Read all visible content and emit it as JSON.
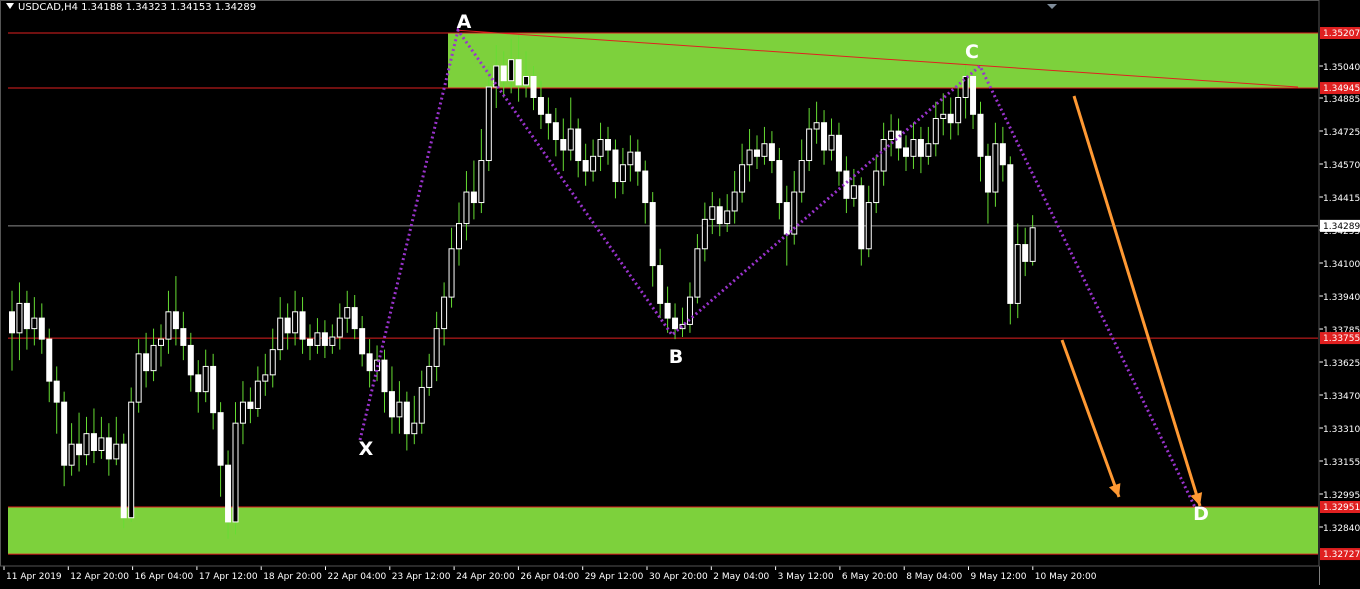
{
  "header": {
    "symbol": "USDCAD,H4",
    "ohlc": "1.34188 1.34323 1.34153 1.34289"
  },
  "colors": {
    "background": "#000000",
    "candle": "#ffffff",
    "wick": "#66dd33",
    "zone_fill": "#7dd13c",
    "level_line": "#e02020",
    "harmonic_line": "#9933cc",
    "arrow": "#ff9933",
    "price_label_bg": "#e02020"
  },
  "chart_data": {
    "type": "candlestick",
    "y_range": [
      1.32727,
      1.3524
    ],
    "price_axis_labels": [
      "1.35040",
      "1.34885",
      "1.34725",
      "1.34570",
      "1.34415",
      "1.34255",
      "1.34100",
      "1.33940",
      "1.33785",
      "1.33625",
      "1.33470",
      "1.33310",
      "1.33155",
      "1.32995",
      "1.32840"
    ],
    "highlighted_prices": [
      "1.35207",
      "1.34945",
      "1.33755",
      "1.32951",
      "1.32727"
    ],
    "current_price": "1.34289",
    "time_labels": [
      "11 Apr 2019",
      "12 Apr 20:00",
      "16 Apr 04:00",
      "17 Apr 12:00",
      "18 Apr 20:00",
      "22 Apr 04:00",
      "23 Apr 12:00",
      "24 Apr 20:00",
      "26 Apr 04:00",
      "29 Apr 12:00",
      "30 Apr 20:00",
      "2 May 04:00",
      "3 May 12:00",
      "6 May 20:00",
      "8 May 04:00",
      "9 May 12:00",
      "10 May 20:00"
    ],
    "zones": [
      {
        "name": "upper",
        "from": 1.34945,
        "to": 1.35207
      },
      {
        "name": "lower",
        "from": 1.32727,
        "to": 1.32951
      }
    ],
    "levels": [
      1.35207,
      1.34945,
      1.33755,
      1.32951,
      1.32727
    ],
    "pattern_points": [
      {
        "label": "X",
        "price": 1.3327
      },
      {
        "label": "A",
        "price": 1.3522
      },
      {
        "label": "B",
        "price": 1.3377
      },
      {
        "label": "C",
        "price": 1.3505
      },
      {
        "label": "D",
        "price": 1.3295
      }
    ],
    "trendline": {
      "from_price": 1.3522,
      "to_price": 1.3495
    },
    "candles": [
      [
        1.3388,
        1.3378,
        1.3398,
        1.336
      ],
      [
        1.3378,
        1.3392,
        1.3402,
        1.3365
      ],
      [
        1.3392,
        1.338,
        1.3398,
        1.337
      ],
      [
        1.338,
        1.3385,
        1.3395,
        1.3372
      ],
      [
        1.3385,
        1.3375,
        1.3392,
        1.3368
      ],
      [
        1.3375,
        1.3355,
        1.338,
        1.3345
      ],
      [
        1.3355,
        1.3345,
        1.3362,
        1.333
      ],
      [
        1.3345,
        1.3315,
        1.335,
        1.3305
      ],
      [
        1.3315,
        1.3325,
        1.3335,
        1.331
      ],
      [
        1.3325,
        1.332,
        1.334,
        1.3312
      ],
      [
        1.332,
        1.333,
        1.3338,
        1.3315
      ],
      [
        1.333,
        1.3322,
        1.3342,
        1.3316
      ],
      [
        1.3322,
        1.3328,
        1.3338,
        1.3318
      ],
      [
        1.3328,
        1.3318,
        1.3335,
        1.331
      ],
      [
        1.3318,
        1.3325,
        1.3338,
        1.3315
      ],
      [
        1.3325,
        1.329,
        1.333,
        1.3285
      ],
      [
        1.329,
        1.3345,
        1.3352,
        1.3288
      ],
      [
        1.3345,
        1.3368,
        1.3375,
        1.334
      ],
      [
        1.3368,
        1.336,
        1.3378,
        1.3352
      ],
      [
        1.336,
        1.3372,
        1.338,
        1.3355
      ],
      [
        1.3372,
        1.3375,
        1.3382,
        1.3362
      ],
      [
        1.3375,
        1.3388,
        1.3398,
        1.3368
      ],
      [
        1.3388,
        1.338,
        1.3405,
        1.3372
      ],
      [
        1.338,
        1.3372,
        1.3388,
        1.3365
      ],
      [
        1.3372,
        1.3358,
        1.3378,
        1.335
      ],
      [
        1.3358,
        1.335,
        1.3365,
        1.334
      ],
      [
        1.335,
        1.3362,
        1.337,
        1.3345
      ],
      [
        1.3362,
        1.334,
        1.3368,
        1.3332
      ],
      [
        1.334,
        1.3315,
        1.3345,
        1.33
      ],
      [
        1.3315,
        1.3288,
        1.3322,
        1.328
      ],
      [
        1.3288,
        1.3335,
        1.3345,
        1.3282
      ],
      [
        1.3335,
        1.3345,
        1.3355,
        1.3325
      ],
      [
        1.3345,
        1.3342,
        1.3352,
        1.3335
      ],
      [
        1.3342,
        1.3355,
        1.3362,
        1.3338
      ],
      [
        1.3355,
        1.3358,
        1.3368,
        1.3348
      ],
      [
        1.3358,
        1.337,
        1.338,
        1.3352
      ],
      [
        1.337,
        1.3385,
        1.3395,
        1.3365
      ],
      [
        1.3385,
        1.3378,
        1.3392,
        1.337
      ],
      [
        1.3378,
        1.3388,
        1.3398,
        1.3372
      ],
      [
        1.3388,
        1.3375,
        1.3395,
        1.3368
      ],
      [
        1.3375,
        1.3372,
        1.3382,
        1.3365
      ],
      [
        1.3372,
        1.3378,
        1.3385,
        1.3368
      ],
      [
        1.3378,
        1.3372,
        1.3384,
        1.3366
      ],
      [
        1.3372,
        1.3376,
        1.3382,
        1.3368
      ],
      [
        1.3376,
        1.3385,
        1.3392,
        1.337
      ],
      [
        1.3385,
        1.339,
        1.3398,
        1.3378
      ],
      [
        1.339,
        1.338,
        1.3396,
        1.3375
      ],
      [
        1.338,
        1.3368,
        1.3386,
        1.3362
      ],
      [
        1.3368,
        1.336,
        1.3375,
        1.3352
      ],
      [
        1.336,
        1.3365,
        1.3372,
        1.3355
      ],
      [
        1.3365,
        1.335,
        1.337,
        1.334
      ],
      [
        1.335,
        1.3338,
        1.3362,
        1.333
      ],
      [
        1.3338,
        1.3345,
        1.3355,
        1.333
      ],
      [
        1.3345,
        1.333,
        1.335,
        1.3322
      ],
      [
        1.333,
        1.3335,
        1.3348,
        1.3325
      ],
      [
        1.3335,
        1.3352,
        1.336,
        1.333
      ],
      [
        1.3352,
        1.3362,
        1.3368,
        1.3348
      ],
      [
        1.3362,
        1.338,
        1.3388,
        1.3355
      ],
      [
        1.338,
        1.3395,
        1.3402,
        1.3372
      ],
      [
        1.3395,
        1.3418,
        1.3428,
        1.339
      ],
      [
        1.3418,
        1.343,
        1.344,
        1.341
      ],
      [
        1.343,
        1.3445,
        1.3455,
        1.3422
      ],
      [
        1.3445,
        1.344,
        1.346,
        1.3432
      ],
      [
        1.344,
        1.346,
        1.3475,
        1.3435
      ],
      [
        1.346,
        1.3495,
        1.3505,
        1.3455
      ],
      [
        1.3495,
        1.3505,
        1.3515,
        1.3485
      ],
      [
        1.3505,
        1.3498,
        1.3512,
        1.349
      ],
      [
        1.3498,
        1.3508,
        1.3518,
        1.3492
      ],
      [
        1.3508,
        1.3496,
        1.352,
        1.3488
      ],
      [
        1.3496,
        1.35,
        1.3512,
        1.349
      ],
      [
        1.35,
        1.349,
        1.3505,
        1.3484
      ],
      [
        1.349,
        1.3482,
        1.3498,
        1.3475
      ],
      [
        1.3482,
        1.3478,
        1.349,
        1.347
      ],
      [
        1.3478,
        1.347,
        1.3485,
        1.3462
      ],
      [
        1.347,
        1.3465,
        1.348,
        1.3455
      ],
      [
        1.3465,
        1.3475,
        1.349,
        1.346
      ],
      [
        1.3475,
        1.346,
        1.348,
        1.3452
      ],
      [
        1.346,
        1.3455,
        1.3468,
        1.3448
      ],
      [
        1.3455,
        1.3462,
        1.347,
        1.345
      ],
      [
        1.3462,
        1.347,
        1.3478,
        1.3455
      ],
      [
        1.347,
        1.3465,
        1.3476,
        1.3458
      ],
      [
        1.3465,
        1.345,
        1.347,
        1.3442
      ],
      [
        1.345,
        1.3458,
        1.3466,
        1.3444
      ],
      [
        1.3458,
        1.3464,
        1.3472,
        1.345
      ],
      [
        1.3464,
        1.3455,
        1.347,
        1.3448
      ],
      [
        1.3455,
        1.344,
        1.346,
        1.343
      ],
      [
        1.344,
        1.341,
        1.3445,
        1.34
      ],
      [
        1.341,
        1.3392,
        1.3418,
        1.3385
      ],
      [
        1.3392,
        1.3385,
        1.34,
        1.3378
      ],
      [
        1.3385,
        1.338,
        1.3392,
        1.3375
      ],
      [
        1.338,
        1.3382,
        1.339,
        1.3376
      ],
      [
        1.3382,
        1.3395,
        1.3402,
        1.3378
      ],
      [
        1.3395,
        1.3418,
        1.3425,
        1.3392
      ],
      [
        1.3418,
        1.3432,
        1.344,
        1.3412
      ],
      [
        1.3432,
        1.3438,
        1.3445,
        1.3425
      ],
      [
        1.3438,
        1.343,
        1.3442,
        1.3424
      ],
      [
        1.343,
        1.3436,
        1.3444,
        1.3426
      ],
      [
        1.3436,
        1.3445,
        1.3455,
        1.343
      ],
      [
        1.3445,
        1.3458,
        1.3468,
        1.344
      ],
      [
        1.3458,
        1.3465,
        1.3475,
        1.345
      ],
      [
        1.3465,
        1.3462,
        1.3472,
        1.3456
      ],
      [
        1.3462,
        1.3468,
        1.3476,
        1.3458
      ],
      [
        1.3468,
        1.346,
        1.3474,
        1.3454
      ],
      [
        1.346,
        1.344,
        1.3466,
        1.3432
      ],
      [
        1.344,
        1.3425,
        1.3448,
        1.341
      ],
      [
        1.3425,
        1.3445,
        1.3455,
        1.342
      ],
      [
        1.3445,
        1.346,
        1.347,
        1.344
      ],
      [
        1.346,
        1.3475,
        1.3485,
        1.3455
      ],
      [
        1.3475,
        1.3478,
        1.3488,
        1.3468
      ],
      [
        1.3478,
        1.3465,
        1.3484,
        1.3458
      ],
      [
        1.3465,
        1.3472,
        1.348,
        1.346
      ],
      [
        1.3472,
        1.3455,
        1.3478,
        1.3448
      ],
      [
        1.3455,
        1.3442,
        1.3462,
        1.3435
      ],
      [
        1.3442,
        1.3448,
        1.3456,
        1.3438
      ],
      [
        1.3448,
        1.3418,
        1.3452,
        1.341
      ],
      [
        1.3418,
        1.344,
        1.3448,
        1.3414
      ],
      [
        1.344,
        1.3455,
        1.3462,
        1.3435
      ],
      [
        1.3455,
        1.347,
        1.3478,
        1.3448
      ],
      [
        1.347,
        1.3474,
        1.3482,
        1.3462
      ],
      [
        1.3474,
        1.3466,
        1.348,
        1.346
      ],
      [
        1.3466,
        1.3462,
        1.3472,
        1.3455
      ],
      [
        1.3462,
        1.347,
        1.3478,
        1.3456
      ],
      [
        1.347,
        1.3462,
        1.3476,
        1.3454
      ],
      [
        1.3462,
        1.3468,
        1.3476,
        1.3458
      ],
      [
        1.3468,
        1.348,
        1.3488,
        1.3462
      ],
      [
        1.348,
        1.3482,
        1.3492,
        1.3472
      ],
      [
        1.3482,
        1.3478,
        1.349,
        1.347
      ],
      [
        1.3478,
        1.349,
        1.3498,
        1.3472
      ],
      [
        1.349,
        1.35,
        1.3506,
        1.348
      ],
      [
        1.35,
        1.3482,
        1.3505,
        1.3475
      ],
      [
        1.3482,
        1.3462,
        1.3488,
        1.345
      ],
      [
        1.3462,
        1.3445,
        1.3468,
        1.343
      ],
      [
        1.3445,
        1.3468,
        1.3478,
        1.3438
      ],
      [
        1.3468,
        1.3458,
        1.3476,
        1.345
      ],
      [
        1.3458,
        1.3392,
        1.3462,
        1.3382
      ],
      [
        1.3392,
        1.342,
        1.343,
        1.3385
      ],
      [
        1.342,
        1.3412,
        1.3428,
        1.3405
      ],
      [
        1.3412,
        1.3428,
        1.3434,
        1.341
      ]
    ],
    "annotations": [
      "X",
      "A",
      "B",
      "C",
      "D"
    ]
  }
}
